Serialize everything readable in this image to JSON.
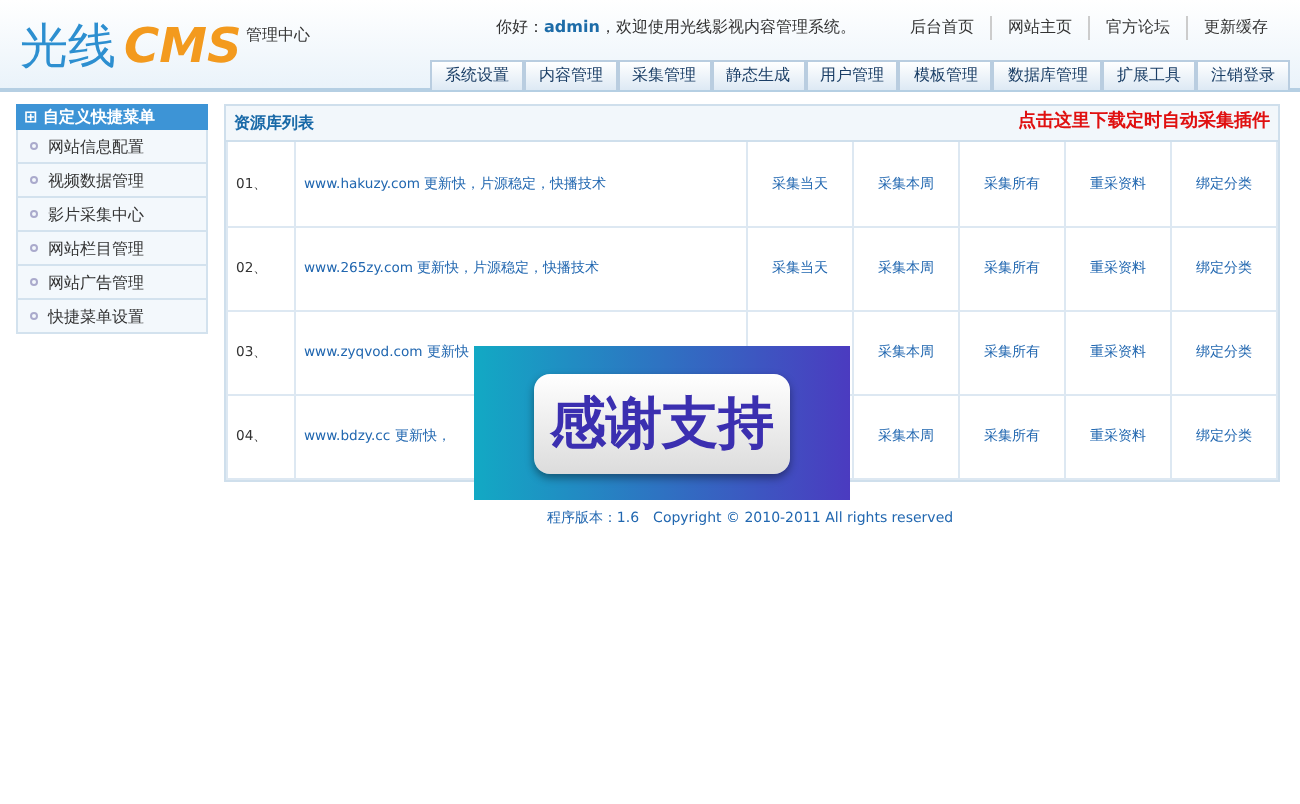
{
  "logo": {
    "title": "光线",
    "brand": "CMS",
    "subtitle": "管理中心"
  },
  "greeting": {
    "prefix": "你好：",
    "user": "admin",
    "suffix": "，欢迎使用光线影视内容管理系统。"
  },
  "top_links": [
    "后台首页",
    "网站主页",
    "官方论坛",
    "更新缓存"
  ],
  "nav_tabs": [
    {
      "label": "系统设置"
    },
    {
      "label": "内容管理"
    },
    {
      "label": "采集管理"
    },
    {
      "label": "静态生成"
    },
    {
      "label": "用户管理"
    },
    {
      "label": "模板管理"
    },
    {
      "label": "数据库管理"
    },
    {
      "label": "扩展工具"
    },
    {
      "label": "注销登录"
    }
  ],
  "sidebar": {
    "title": "自定义快捷菜单",
    "toggle": "⊞",
    "items": [
      "网站信息配置",
      "视频数据管理",
      "影片采集中心",
      "网站栏目管理",
      "网站广告管理",
      "快捷菜单设置"
    ]
  },
  "panel": {
    "title": "资源库列表",
    "notice": "点击这里下载定时自动采集插件",
    "rows": [
      {
        "index": "01、",
        "description": "www.hakuzy.com 更新快，片源稳定，快播技术",
        "actions": [
          "采集当天",
          "采集本周",
          "采集所有",
          "重采资料",
          "绑定分类"
        ]
      },
      {
        "index": "02、",
        "description": "www.265zy.com 更新快，片源稳定，快播技术",
        "actions": [
          "采集当天",
          "采集本周",
          "采集所有",
          "重采资料",
          "绑定分类"
        ]
      },
      {
        "index": "03、",
        "description": "www.zyqvod.com 更新快",
        "actions": [
          "采集本周",
          "采集所有",
          "重采资料",
          "绑定分类"
        ]
      },
      {
        "index": "04、",
        "description": "www.bdzy.cc 更新快，",
        "actions": [
          "采集本周",
          "采集所有",
          "重采资料",
          "绑定分类"
        ]
      }
    ]
  },
  "footer": "程序版本：1.6　Copyright © 2010-2011 All rights reserved",
  "overlay": {
    "text": "感谢支持"
  }
}
